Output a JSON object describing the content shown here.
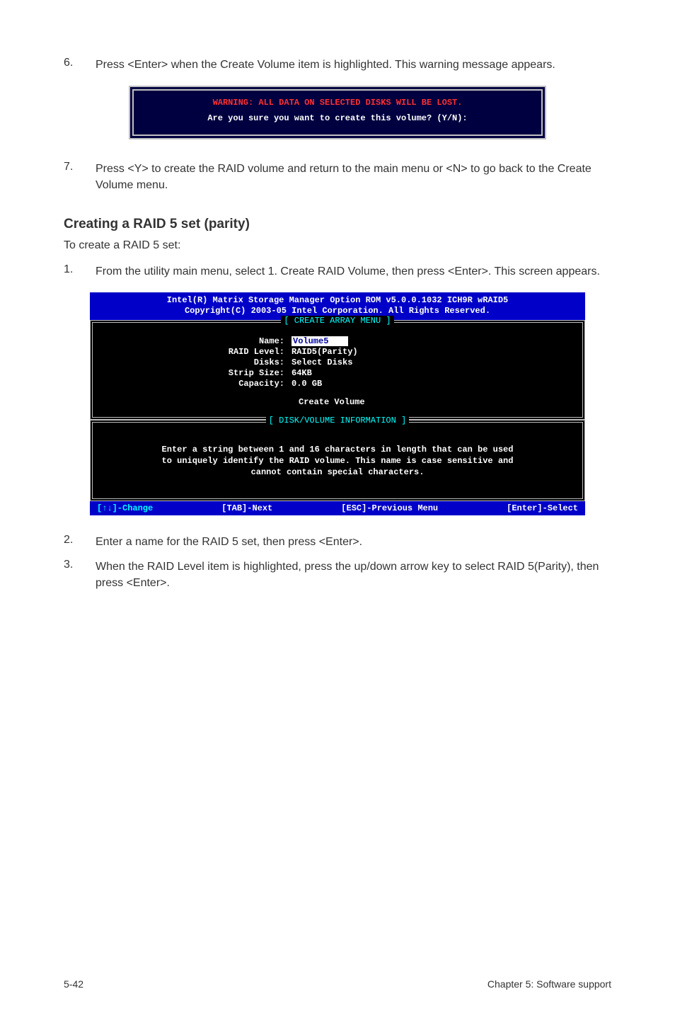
{
  "step6": {
    "num": "6.",
    "text": "Press <Enter> when the Create Volume item is highlighted. This warning message appears."
  },
  "warning": {
    "red": "WARNING: ALL DATA ON SELECTED DISKS WILL BE LOST.",
    "white": "Are you sure you want to create this volume? (Y/N):"
  },
  "step7": {
    "num": "7.",
    "text": "Press <Y> to create the RAID volume and return to the main menu or <N> to go back to the Create Volume menu."
  },
  "heading": "Creating a RAID 5 set (parity)",
  "subtext": "To create a RAID 5 set:",
  "step1": {
    "num": "1.",
    "text": "From the utility main menu, select 1. Create RAID Volume, then press <Enter>. This screen appears."
  },
  "raid": {
    "title1": "Intel(R) Matrix Storage Manager Option ROM v5.0.0.1032 ICH9R wRAID5",
    "title2": "Copyright(C) 2003-05 Intel Corporation. All Rights Reserved.",
    "menu_title": "[ CREATE ARRAY MENU ]",
    "fields": {
      "name_label": "Name:",
      "name_value": "Volume5",
      "raid_level_label": "RAID Level:",
      "raid_level_value": "RAID5(Parity)",
      "disks_label": "Disks:",
      "disks_value": "Select Disks",
      "strip_label": "Strip Size:",
      "strip_value": "64KB",
      "capacity_label": "Capacity:",
      "capacity_value": "0.0  GB"
    },
    "create_volume": "Create Volume",
    "info_title": "[ DISK/VOLUME INFORMATION ]",
    "info_line1": "Enter a string between 1 and 16 characters in length that can be used",
    "info_line2": "to uniquely identify the RAID volume. This name is case sensitive and",
    "info_line3": "cannot contain special characters.",
    "footer": {
      "change": "[↑↓]-Change",
      "next": "[TAB]-Next",
      "prev": "[ESC]-Previous Menu",
      "select": "[Enter]-Select"
    }
  },
  "step2": {
    "num": "2.",
    "text": "Enter a name for the RAID 5 set, then press <Enter>."
  },
  "step3": {
    "num": "3.",
    "text": "When the RAID Level item is highlighted, press the up/down arrow key to select RAID 5(Parity), then press <Enter>."
  },
  "footer": {
    "left": "5-42",
    "right": "Chapter 5: Software support"
  }
}
